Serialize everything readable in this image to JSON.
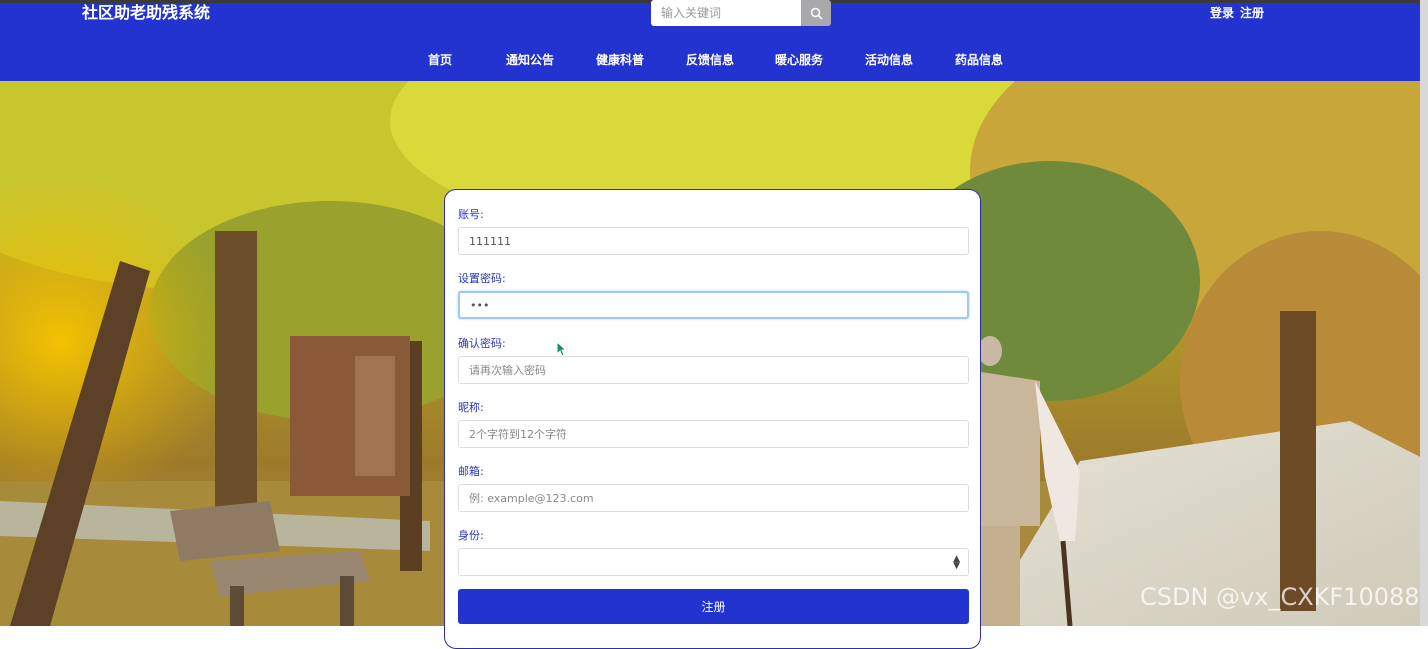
{
  "header": {
    "site_title": "社区助老助残系统",
    "search": {
      "placeholder": "输入关键词"
    },
    "auth": {
      "login": "登录",
      "register": "注册"
    },
    "nav": [
      "首页",
      "通知公告",
      "健康科普",
      "反馈信息",
      "暖心服务",
      "活动信息",
      "药品信息"
    ]
  },
  "form": {
    "account": {
      "label": "账号:",
      "value": "111111"
    },
    "password": {
      "label": "设置密码:",
      "value": "•••"
    },
    "confirm_password": {
      "label": "确认密码:",
      "placeholder": "请再次输入密码"
    },
    "nickname": {
      "label": "昵称:",
      "placeholder": "2个字符到12个字符"
    },
    "email": {
      "label": "邮箱:",
      "placeholder": "例: example@123.com"
    },
    "identity": {
      "label": "身份:",
      "selected": ""
    },
    "submit_label": "注册"
  },
  "watermark": "CSDN @vx_CXKF10088",
  "colors": {
    "primary": "#2233d0",
    "label": "#2b35b8"
  }
}
